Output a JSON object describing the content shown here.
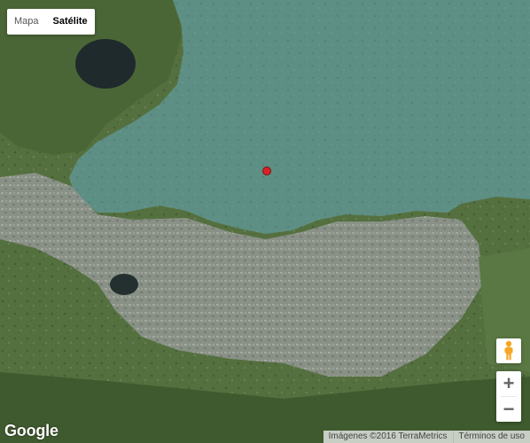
{
  "map_type": {
    "options": [
      {
        "label": "Mapa",
        "selected": false
      },
      {
        "label": "Satélite",
        "selected": true
      }
    ]
  },
  "controls": {
    "pegman_icon": "pegman-icon",
    "zoom_in_label": "+",
    "zoom_out_label": "−"
  },
  "footer": {
    "logo": "Google",
    "attribution": "Imágenes ©2016 TerraMetrics",
    "terms": "Términos de uso"
  },
  "colors": {
    "water": "#5e8f84",
    "land": "#55703f",
    "urban": "#8d938c",
    "marker": "#d9232a"
  }
}
